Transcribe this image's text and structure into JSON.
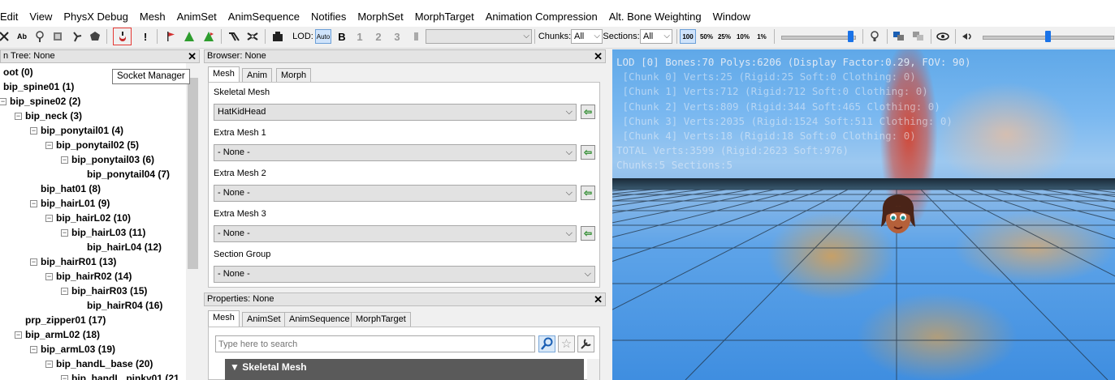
{
  "menu": [
    "Edit",
    "View",
    "PhysX Debug",
    "Mesh",
    "AnimSet",
    "AnimSequence",
    "Notifies",
    "MorphSet",
    "MorphTarget",
    "Animation Compression",
    "Alt. Bone Weighting",
    "Window"
  ],
  "toolbar": {
    "lod_label": "LOD:",
    "lod_auto": "Auto",
    "lod_levels": [
      "B",
      "1",
      "2",
      "3"
    ],
    "chunks_label": "Chunks:",
    "chunks_value": "All",
    "sections_label": "Sections:",
    "sections_value": "All",
    "zoom_levels": [
      "100",
      "50%",
      "25%",
      "10%",
      "1%"
    ],
    "tooltip": "Socket Manager",
    "colors": {
      "highlight_box": "#e53935",
      "slider_thumb": "#1a73e8"
    }
  },
  "tree": {
    "title": "n Tree: None",
    "rows": [
      {
        "label": "oot (0)",
        "depth": 0,
        "expander": false
      },
      {
        "label": "bip_spine01 (1)",
        "depth": 0,
        "expander": true
      },
      {
        "label": "bip_spine02 (2)",
        "depth": 1,
        "expander": true
      },
      {
        "label": "bip_neck (3)",
        "depth": 2,
        "expander": true
      },
      {
        "label": "bip_ponytail01 (4)",
        "depth": 3,
        "expander": true
      },
      {
        "label": "bip_ponytail02 (5)",
        "depth": 4,
        "expander": true
      },
      {
        "label": "bip_ponytail03 (6)",
        "depth": 5,
        "expander": true
      },
      {
        "label": "bip_ponytail04 (7)",
        "depth": 6,
        "expander": false
      },
      {
        "label": "bip_hat01 (8)",
        "depth": 3,
        "expander": false
      },
      {
        "label": "bip_hairL01 (9)",
        "depth": 3,
        "expander": true
      },
      {
        "label": "bip_hairL02 (10)",
        "depth": 4,
        "expander": true
      },
      {
        "label": "bip_hairL03 (11)",
        "depth": 5,
        "expander": true
      },
      {
        "label": "bip_hairL04 (12)",
        "depth": 6,
        "expander": false
      },
      {
        "label": "bip_hairR01 (13)",
        "depth": 3,
        "expander": true
      },
      {
        "label": "bip_hairR02 (14)",
        "depth": 4,
        "expander": true
      },
      {
        "label": "bip_hairR03 (15)",
        "depth": 5,
        "expander": true
      },
      {
        "label": "bip_hairR04 (16)",
        "depth": 6,
        "expander": false
      },
      {
        "label": "prp_zipper01 (17)",
        "depth": 2,
        "expander": false
      },
      {
        "label": "bip_armL02 (18)",
        "depth": 2,
        "expander": true
      },
      {
        "label": "bip_armL03 (19)",
        "depth": 3,
        "expander": true
      },
      {
        "label": "bip_handL_base (20)",
        "depth": 4,
        "expander": true
      },
      {
        "label": "bip_handL_pinky01 (21",
        "depth": 5,
        "expander": true
      }
    ]
  },
  "browser": {
    "title": "Browser: None",
    "tabs": [
      "Mesh",
      "Anim",
      "Morph"
    ],
    "fields": [
      {
        "label": "Skeletal Mesh",
        "value": "HatKidHead"
      },
      {
        "label": "Extra Mesh 1",
        "value": "- None -"
      },
      {
        "label": "Extra Mesh 2",
        "value": "- None -"
      },
      {
        "label": "Extra Mesh 3",
        "value": "- None -"
      },
      {
        "label": "Section Group",
        "value": "- None -"
      }
    ]
  },
  "properties": {
    "title": "Properties: None",
    "tabs": [
      "Mesh",
      "AnimSet",
      "AnimSequence",
      "MorphTarget"
    ],
    "search_placeholder": "Type here to search",
    "category": "Skeletal Mesh"
  },
  "viewport": {
    "lines": [
      {
        "text": "LOD [0] Bones:70 Polys:6206 (Display Factor:0.29, FOV: 90)",
        "dim": false
      },
      {
        "text": " [Chunk 0] Verts:25 (Rigid:25 Soft:0 Clothing: 0)",
        "dim": true
      },
      {
        "text": " [Chunk 1] Verts:712 (Rigid:712 Soft:0 Clothing: 0)",
        "dim": true
      },
      {
        "text": " [Chunk 2] Verts:809 (Rigid:344 Soft:465 Clothing: 0)",
        "dim": true
      },
      {
        "text": " [Chunk 3] Verts:2035 (Rigid:1524 Soft:511 Clothing: 0)",
        "dim": true
      },
      {
        "text": " [Chunk 4] Verts:18 (Rigid:18 Soft:0 Clothing: 0)",
        "dim": true
      },
      {
        "text": "TOTAL Verts:3599 (Rigid:2623 Soft:976)",
        "dim": true
      },
      {
        "text": "Chunks:5 Sections:5",
        "dim": true
      }
    ]
  }
}
